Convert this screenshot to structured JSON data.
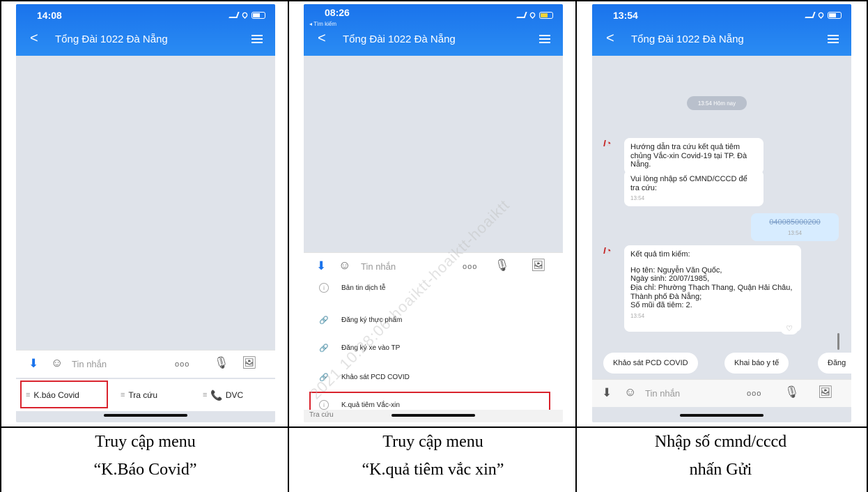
{
  "panels": [
    {
      "status_time": "14:08",
      "header_title": "Tổng Đài 1022 Đà Nẵng",
      "input_placeholder": "Tin nhắn",
      "menu_tabs": [
        "K.báo Covid",
        "Tra cứu",
        "DVC"
      ],
      "caption_line1": "Truy cập menu",
      "caption_line2": "“K.Báo Covid”"
    },
    {
      "status_time": "08:26",
      "status_sub": "◂ Tìm kiếm",
      "header_title": "Tổng Đài 1022 Đà Nẵng",
      "input_placeholder": "Tin nhắn",
      "menu_items": [
        "Bản tin dịch tễ",
        "Đăng ký thực phẩm",
        "Đăng ký xe vào TP",
        "Khảo sát PCD COVID",
        "K.quả tiêm Vắc-xin"
      ],
      "footer_tab": "Tra cứu",
      "caption_line1": "Truy cập menu",
      "caption_line2": "“K.quả tiêm vắc xin”"
    },
    {
      "status_time": "13:54",
      "header_title": "Tổng Đài 1022 Đà Nẵng",
      "date_pill": "13:54 Hôm nay",
      "bot_msg1": "Hướng dẫn tra cứu kết quả tiêm chủng Vắc-xin Covid-19 tại TP. Đà Nẵng.",
      "bot_msg2": "Vui lòng nhập số CMND/CCCD để tra cứu:",
      "bot_msg2_time": "13:54",
      "user_msg": "040085000200",
      "user_msg_time": "13:54",
      "result_title": "Kết quả tìm kiếm:",
      "result_lines": [
        "Họ tên: Nguyễn Văn Quốc,",
        "Ngày sinh: 20/07/1985,",
        "Địa chỉ: Phường Thạch Thang, Quận Hải Châu, Thành phố Đà Nẵng;",
        "Số mũi đã tiêm: 2."
      ],
      "result_time": "13:54",
      "quick_replies": [
        "Khảo sát PCD COVID",
        "Khai báo y tế",
        "Đăng"
      ],
      "input_placeholder": "Tin nhắn",
      "caption_line1": "Nhập số cmnd/cccd",
      "caption_line2": "nhấn Gửi"
    }
  ],
  "watermark": "2021 10:28:06-hoaiktt-hoaiktt-hoaiktt"
}
